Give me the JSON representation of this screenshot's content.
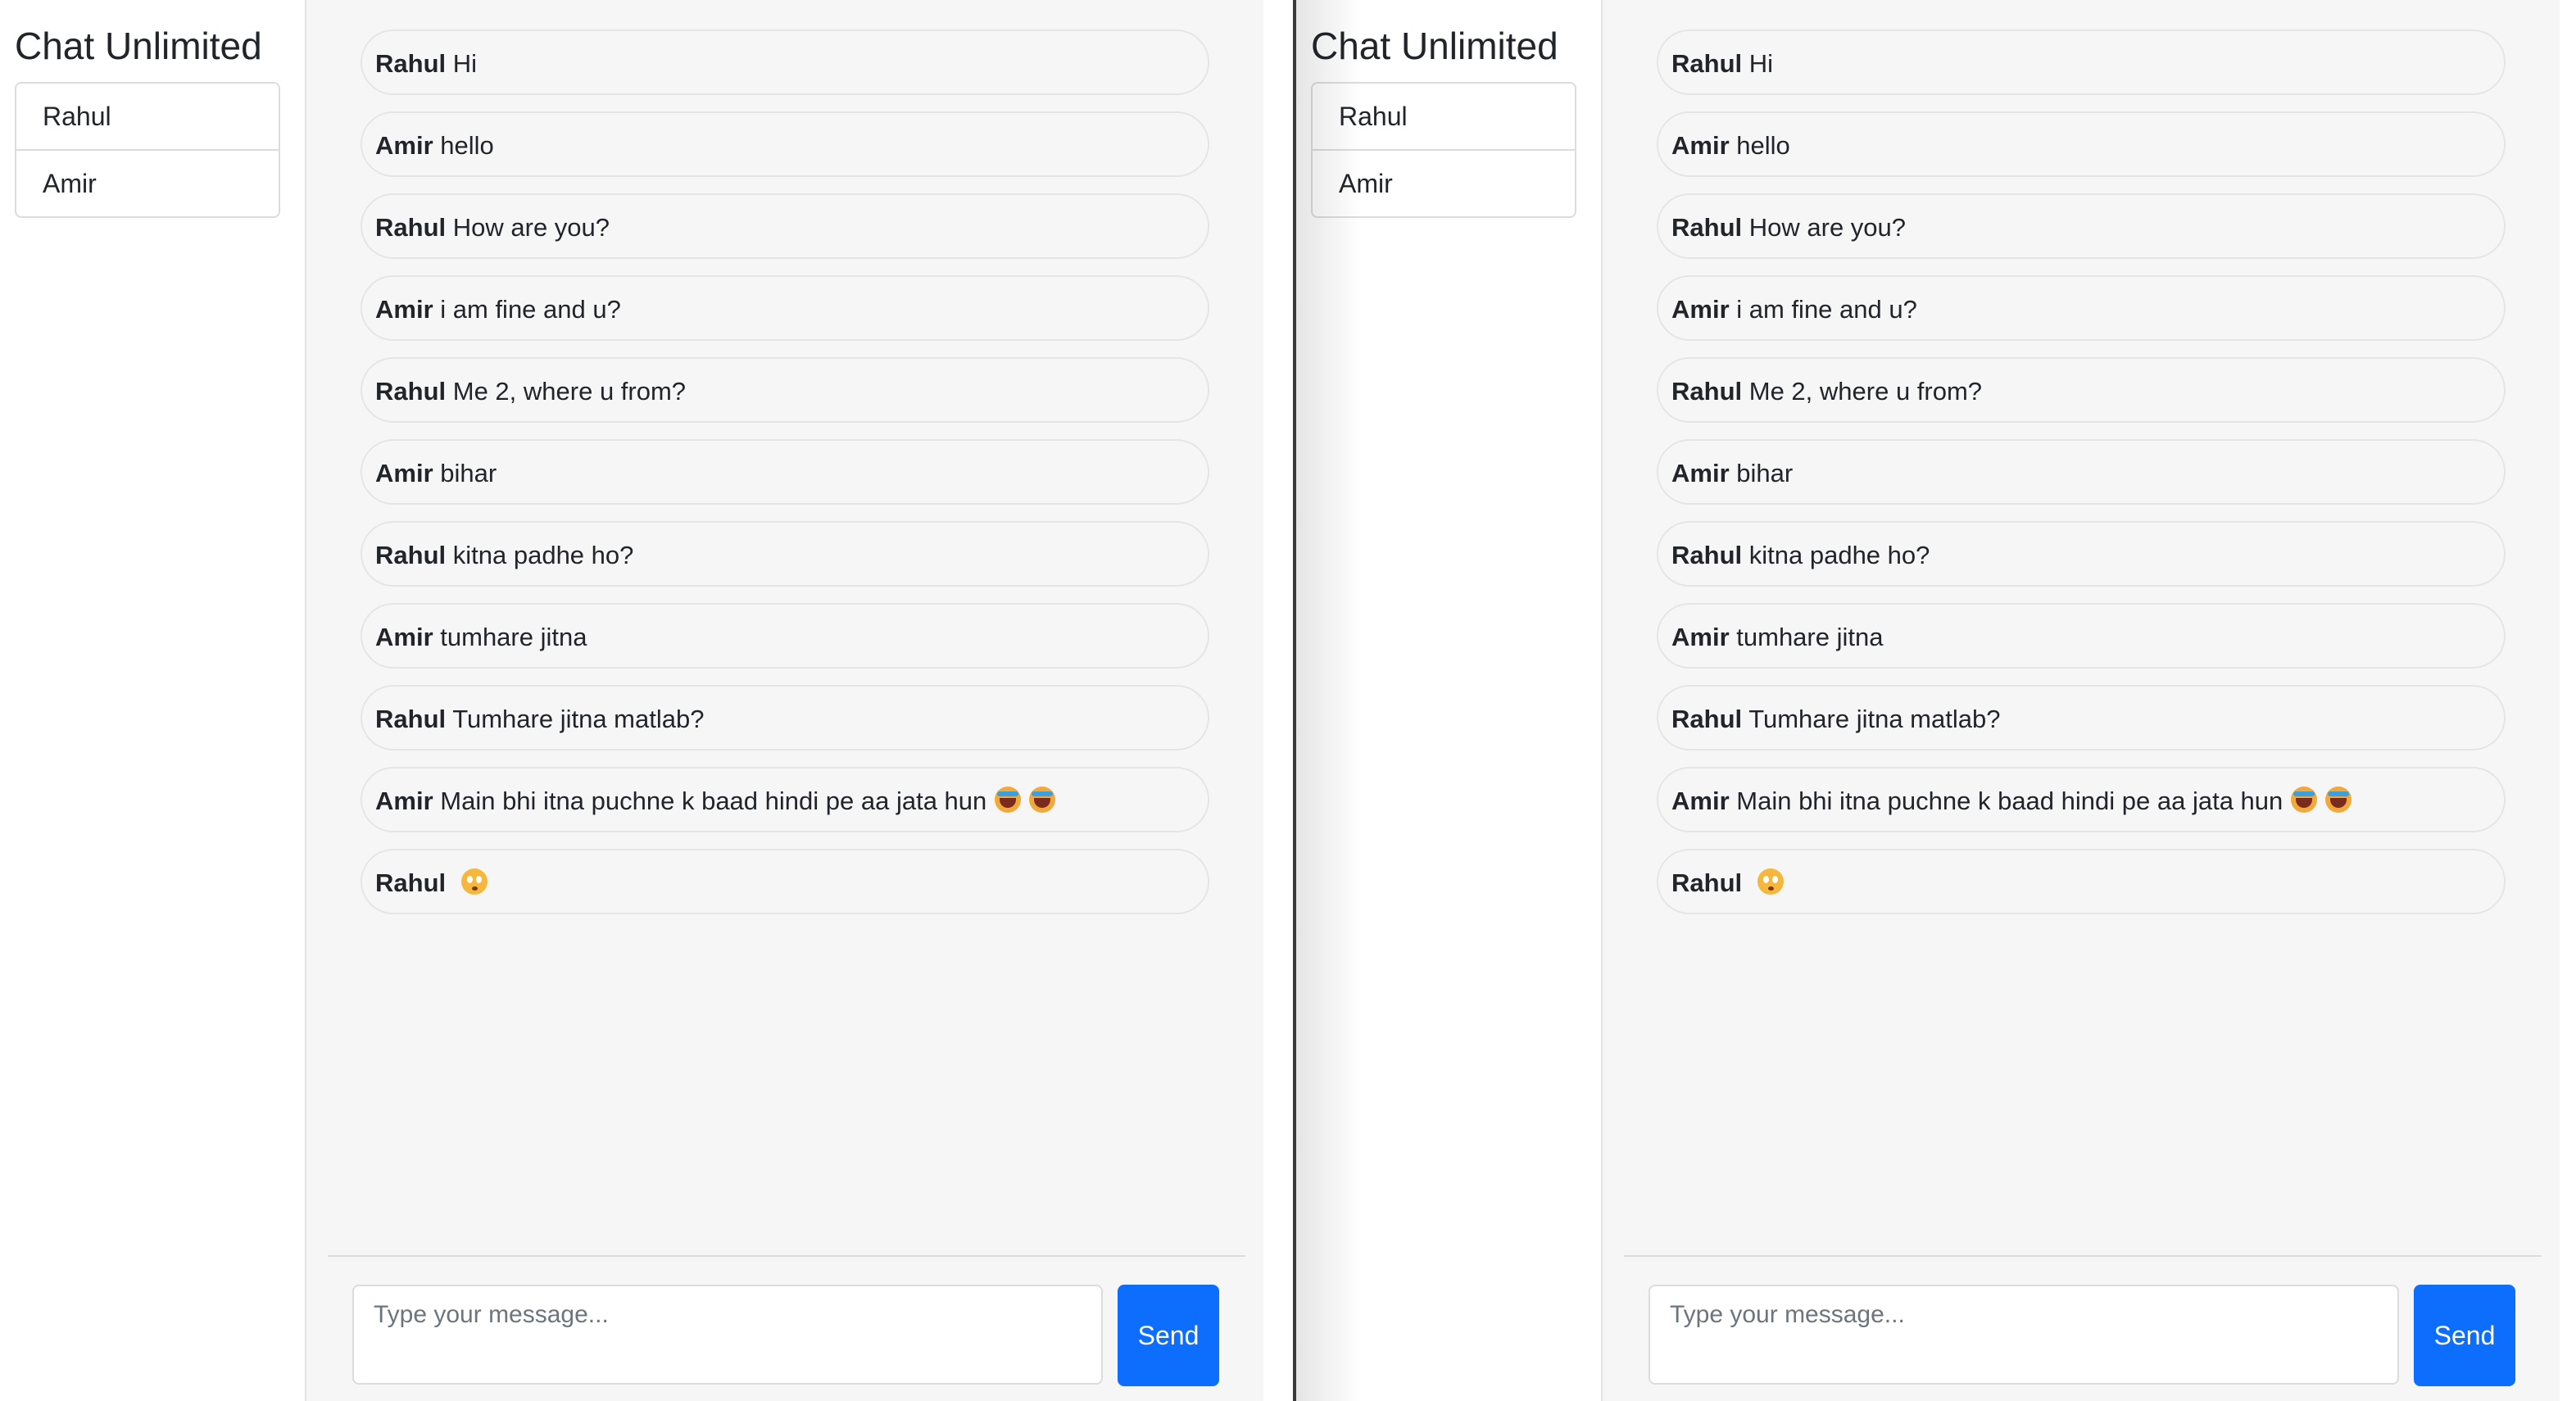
{
  "app": {
    "title": "Chat Unlimited"
  },
  "contacts": [
    "Rahul",
    "Amir"
  ],
  "messages": [
    {
      "sender": "Rahul",
      "text": "Hi",
      "emojis": []
    },
    {
      "sender": "Amir",
      "text": "hello",
      "emojis": []
    },
    {
      "sender": "Rahul",
      "text": "How are you?",
      "emojis": []
    },
    {
      "sender": "Amir",
      "text": "i am fine and u?",
      "emojis": []
    },
    {
      "sender": "Rahul",
      "text": "Me 2, where u from?",
      "emojis": []
    },
    {
      "sender": "Amir",
      "text": "bihar",
      "emojis": []
    },
    {
      "sender": "Rahul",
      "text": "kitna padhe ho?",
      "emojis": []
    },
    {
      "sender": "Amir",
      "text": "tumhare jitna",
      "emojis": []
    },
    {
      "sender": "Rahul",
      "text": "Tumhare jitna matlab?",
      "emojis": []
    },
    {
      "sender": "Amir",
      "text": "Main bhi itna puchne k baad hindi pe aa jata hun",
      "emojis": [
        "laughing-crying-emoji",
        "laughing-crying-emoji"
      ]
    },
    {
      "sender": "Rahul",
      "text": "",
      "emojis": [
        "flushed-face-emoji"
      ]
    }
  ],
  "composer": {
    "placeholder": "Type your message...",
    "send_label": "Send"
  },
  "colors": {
    "accent": "#0d6efd",
    "chat_background": "#f6f6f6"
  }
}
